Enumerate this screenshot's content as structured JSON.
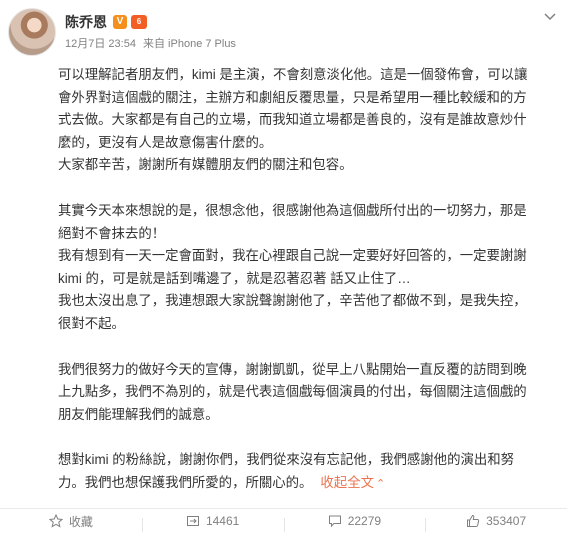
{
  "header": {
    "user_name": "陈乔恩",
    "verified_badge": "V",
    "level_badge": "6",
    "timestamp": "12月7日 23:54",
    "source": "来自 iPhone 7 Plus",
    "avatar_icon": "avatar",
    "menu_icon": "chevron-down-icon"
  },
  "post": {
    "paragraphs": [
      "可以理解記者朋友們，kimi 是主演，不會刻意淡化他。這是一個發佈會，可以讓",
      "會外界對這個戲的關注，主辦方和劇組反覆思量，只是希望用一種比較緩和的方",
      "式去做。大家都是有自己的立場，而我知道立場都是善良的，沒有是誰故意炒什",
      "麼的，更沒有人是故意傷害什麼的。",
      "大家都辛苦，謝謝所有媒體朋友們的關注和包容。",
      "",
      "其實今天本來想說的是，很想念他，很感謝他為這個戲所付出的一切努力，那是",
      "絕對不會抹去的！",
      "我有想到有一天一定會面對，我在心裡跟自己說一定要好好回答的，一定要謝謝",
      "kimi 的，可是就是話到嘴邊了，就是忍著忍著 話又止住了…",
      "我也太沒出息了，我連想跟大家說聲謝謝他了，辛苦他了都做不到，是我失控，",
      "很對不起。",
      "",
      "我們很努力的做好今天的宣傳，謝謝凱凱，從早上八點開始一直反覆的訪問到晚",
      "上九點多，我們不為別的，就是代表這個戲每個演員的付出，每個關注這個戲的",
      "朋友們能理解我們的誠意。",
      "",
      "想對kimi 的粉絲說，謝謝你們，我們從來沒有忘記他，我們感謝他的演出和努"
    ],
    "last_line": "力。我們也想保護我們所愛的，所關心的。",
    "collapse_label": "收起全文",
    "collapse_arrow": "⌃"
  },
  "footer": {
    "favorite_label": "收藏",
    "repost_count": "14461",
    "comment_count": "22279",
    "like_count": "353407"
  },
  "colors": {
    "accent_link": "#eb7350",
    "muted_text": "#808080",
    "body_text": "#333333"
  }
}
